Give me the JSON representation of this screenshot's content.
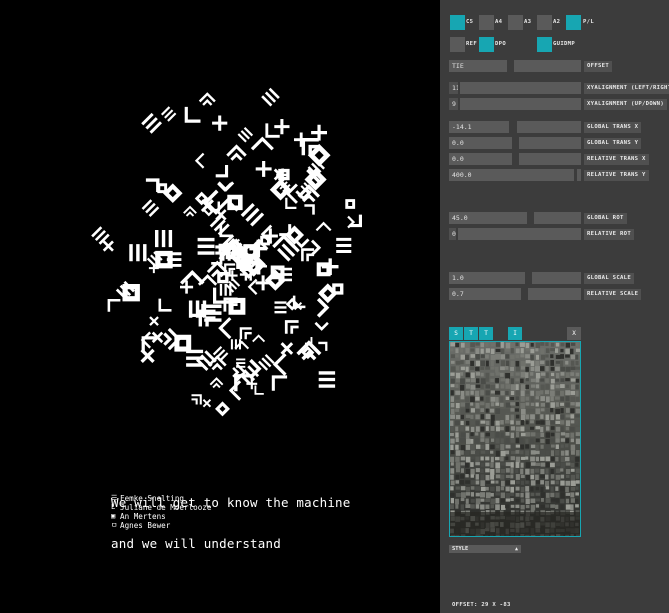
{
  "poster": {
    "title_line1": "We will get to know the machine",
    "title_line2": "and we will understand",
    "authors": [
      {
        "mark": "☰",
        "name": "Femke Snelting"
      },
      {
        "mark": "L",
        "name": "Juliane de Moerlooze"
      },
      {
        "mark": "▣",
        "name": "An Mertens"
      },
      {
        "mark": "ㅁ",
        "name": "Agnes Bewer"
      }
    ]
  },
  "panel": {
    "formats": [
      {
        "label": "C5",
        "active": true
      },
      {
        "label": "A4",
        "active": false
      },
      {
        "label": "A3",
        "active": false
      },
      {
        "label": "A2",
        "active": false
      },
      {
        "label": "P/L",
        "active": true
      }
    ],
    "modes": [
      {
        "label": "REF",
        "active": false
      },
      {
        "label": "DPO",
        "active": true
      },
      {
        "label": "GUIDMP",
        "active": true
      }
    ],
    "offset": {
      "value": "TIE",
      "label": "OFFSET"
    },
    "xyalignment_lr": {
      "value": "11",
      "label": "XYALIGNMENT (LEFT/RIGHT)"
    },
    "xyalignment_ud": {
      "value": "9",
      "label": "XYALIGNMENT (UP/DOWN)"
    },
    "global_trans_x": {
      "value": "-14.1",
      "label": "GLOBAL TRANS X"
    },
    "global_trans_y": {
      "value": "0.0",
      "label": "GLOBAL TRANS Y"
    },
    "relative_trans_x": {
      "value": "0.0",
      "label": "RELATIVE TRANS X"
    },
    "relative_trans_y": {
      "value": "400.0",
      "label": "RELATIVE TRANS Y"
    },
    "global_rot": {
      "value": "45.0",
      "label": "GLOBAL ROT"
    },
    "relative_rot": {
      "value": "0.0",
      "label": "RELATIVE ROT"
    },
    "global_scale": {
      "value": "1.0",
      "label": "GLOBAL SCALE"
    },
    "relative_scale": {
      "value": "0.7",
      "label": "RELATIVE SCALE"
    },
    "tabs": [
      "S",
      "T",
      "T",
      "I"
    ],
    "tab_close": "X",
    "style_select": "STYLE",
    "offset_readout": "OFFSET: 29 X -83"
  },
  "colors": {
    "accent": "#17a6b2",
    "panel_bg": "#3c3c3c",
    "control": "#5a5a5a"
  }
}
